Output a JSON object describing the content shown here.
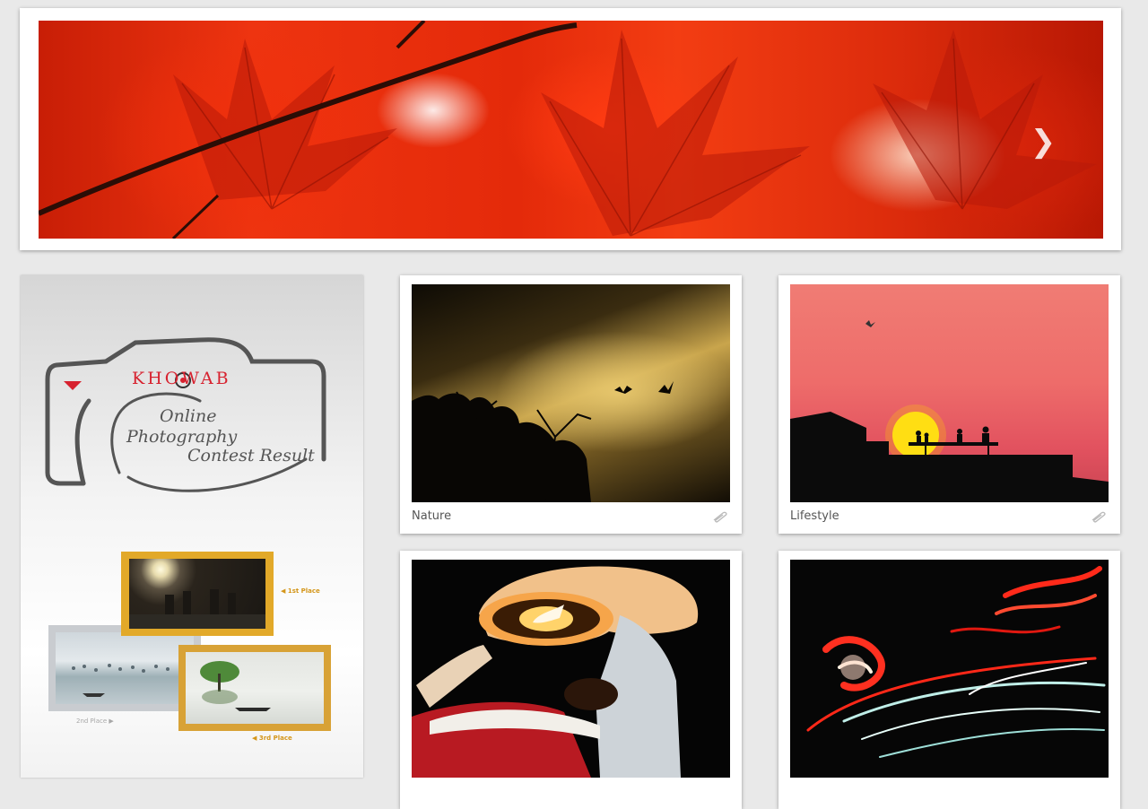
{
  "banner": {
    "image_icon": "red-maple-leaves-image",
    "next_icon": "chevron-right-icon",
    "next_glyph": "❯"
  },
  "promo": {
    "brand": "KHOWAB",
    "line1": "Online",
    "line2": "Photography",
    "line3": "Contest Result",
    "first_place": "◀ 1st Place",
    "second_place": "2nd Place ▶",
    "third_place": "◀ 3rd Place",
    "accent_color": "#d7222f",
    "gold_color": "#e2a929"
  },
  "gallery": [
    {
      "category": "Nature",
      "icon": "paperclip-icon"
    },
    {
      "category": "Lifestyle",
      "icon": "paperclip-icon"
    },
    {
      "category": "",
      "icon": "paperclip-icon"
    },
    {
      "category": "",
      "icon": "paperclip-icon"
    }
  ]
}
